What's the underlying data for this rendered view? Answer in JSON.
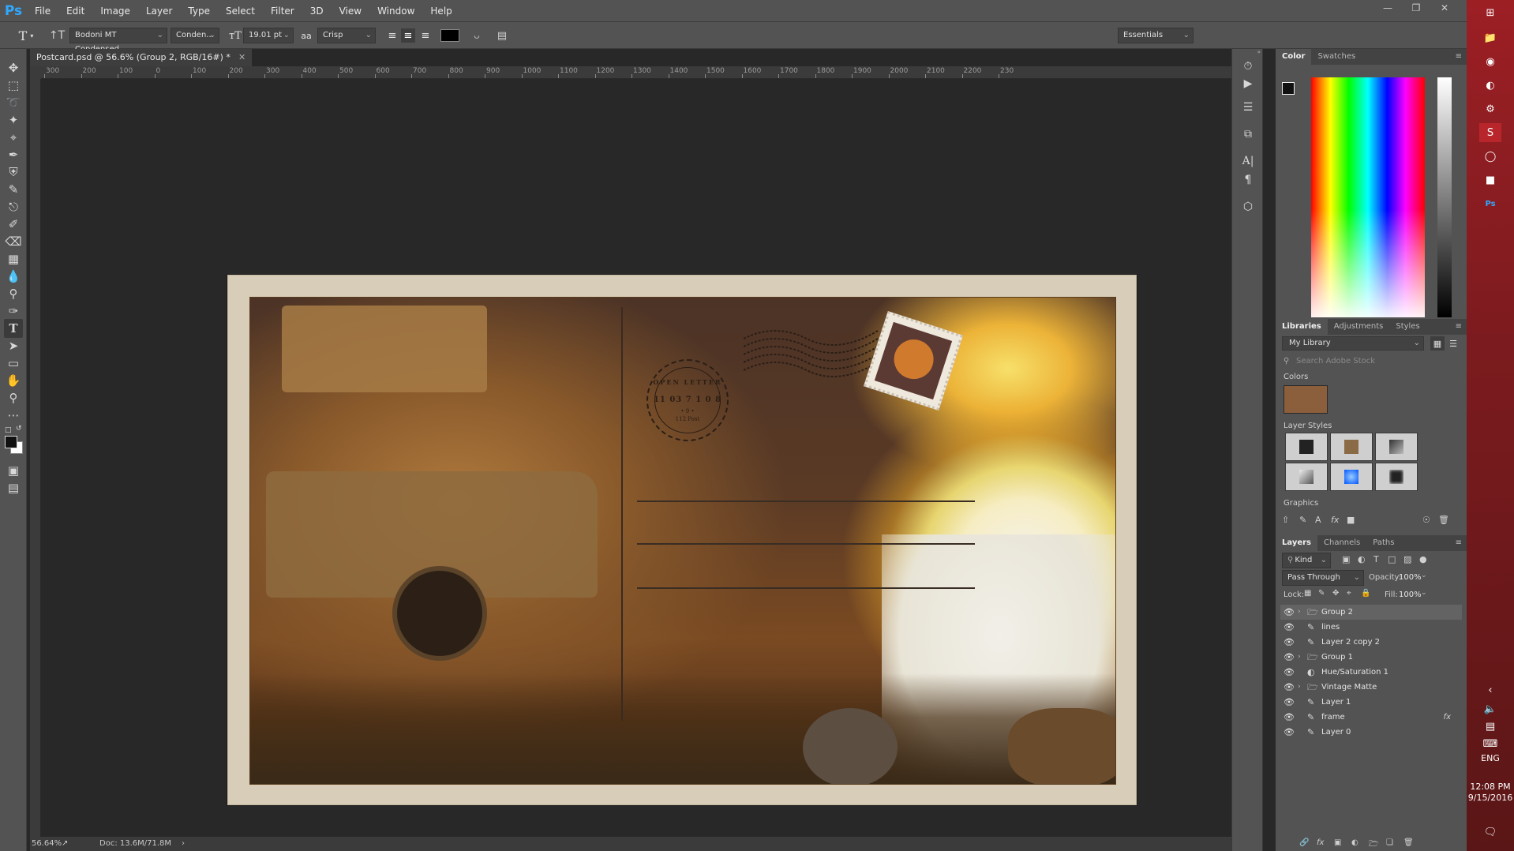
{
  "app": {
    "logo": "Ps"
  },
  "menu": [
    "File",
    "Edit",
    "Image",
    "Layer",
    "Type",
    "Select",
    "Filter",
    "3D",
    "View",
    "Window",
    "Help"
  ],
  "window_controls": [
    "minimize-icon",
    "restore-icon",
    "close-icon"
  ],
  "options": {
    "font_family": "Bodoni MT Condensed ...",
    "font_style": "Conden...",
    "font_size": "19.01 pt",
    "aa_glyph": "aa",
    "antialias": "Crisp",
    "text_color": "#000000",
    "workspace": "Essentials"
  },
  "document": {
    "tab_title": "Postcard.psd @ 56.6% (Group 2, RGB/16#) *",
    "zoom": "56.64%",
    "doc_size": "Doc: 13.6M/71.8M"
  },
  "ruler": {
    "top_labels": [
      "300",
      "200",
      "100",
      "0",
      "100",
      "200",
      "300",
      "400",
      "500",
      "600",
      "700",
      "800",
      "900",
      "1000",
      "1100",
      "1200",
      "1300",
      "1400",
      "1500",
      "1600",
      "1700",
      "1800",
      "1900",
      "2000",
      "2100",
      "2200",
      "230"
    ]
  },
  "postcard": {
    "postmark_top": "OPEN LETTER",
    "postmark_date": "11 03 7 1 0 8",
    "postmark_star": "• 9 •",
    "postmark_bottom": "112 Post"
  },
  "color_panel": {
    "tabs": [
      "Color",
      "Swatches"
    ],
    "foreground": "#000000",
    "background": "#ffffff"
  },
  "libraries": {
    "tabs": [
      "Libraries",
      "Adjustments",
      "Styles"
    ],
    "library_name": "My Library",
    "search_placeholder": "Search Adobe Stock",
    "colors_label": "Colors",
    "color_swatch": "#8b5e3c",
    "layer_styles_label": "Layer Styles",
    "graphics_label": "Graphics"
  },
  "layers_panel": {
    "tabs": [
      "Layers",
      "Channels",
      "Paths"
    ],
    "filter_kind": "Kind",
    "blend_mode": "Pass Through",
    "opacity_label": "Opacity:",
    "opacity_value": "100%",
    "lock_label": "Lock:",
    "fill_label": "Fill:",
    "fill_value": "100%",
    "layers": [
      {
        "name": "Group 2",
        "type": "group"
      },
      {
        "name": "lines",
        "type": "brush"
      },
      {
        "name": "Layer 2 copy 2",
        "type": "brush"
      },
      {
        "name": "Group 1",
        "type": "group"
      },
      {
        "name": "Hue/Saturation 1",
        "type": "adjustment"
      },
      {
        "name": "Vintage Matte",
        "type": "group"
      },
      {
        "name": "Layer 1",
        "type": "brush"
      },
      {
        "name": "frame",
        "type": "brush",
        "fx": "fx"
      },
      {
        "name": "Layer 0",
        "type": "brush"
      }
    ]
  },
  "taskbar": {
    "lang": "ENG",
    "time": "12:08 PM",
    "date": "9/15/2016"
  }
}
